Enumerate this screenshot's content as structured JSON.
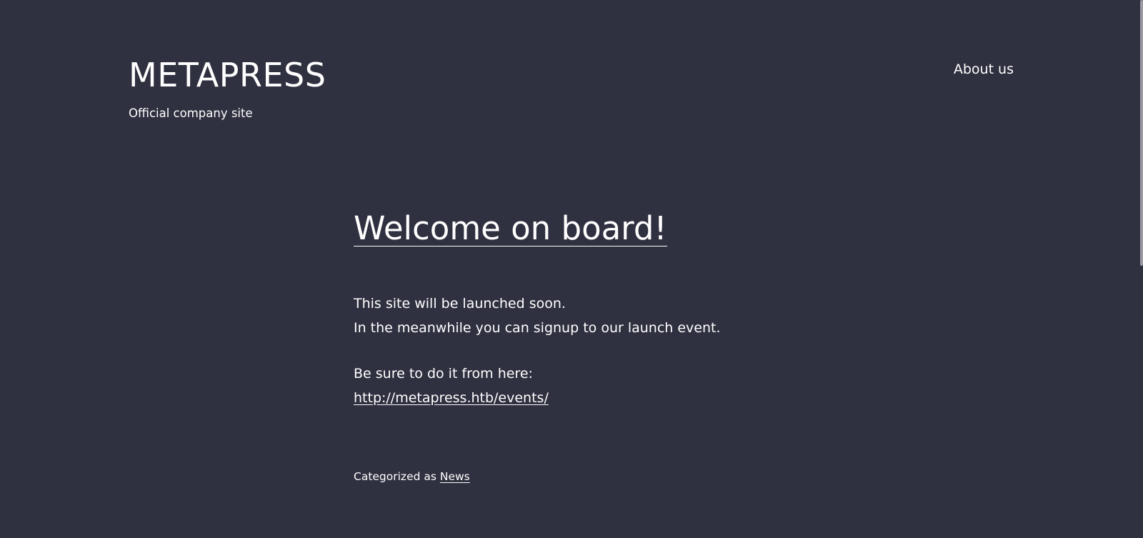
{
  "header": {
    "site_title": "METAPRESS",
    "tagline": "Official company site",
    "nav": {
      "about_label": "About us"
    }
  },
  "post": {
    "title": "Welcome on board!",
    "paragraph1_line1": "This site will be launched soon.",
    "paragraph1_line2": "In the meanwhile you can signup to our launch event.",
    "paragraph2_line1": "Be sure to do it from here:",
    "events_link": "http://metapress.htb/events/",
    "categorized_prefix": "Categorized as",
    "category_label": "News"
  },
  "colors": {
    "background": "#2f3040",
    "text": "#ffffff"
  }
}
